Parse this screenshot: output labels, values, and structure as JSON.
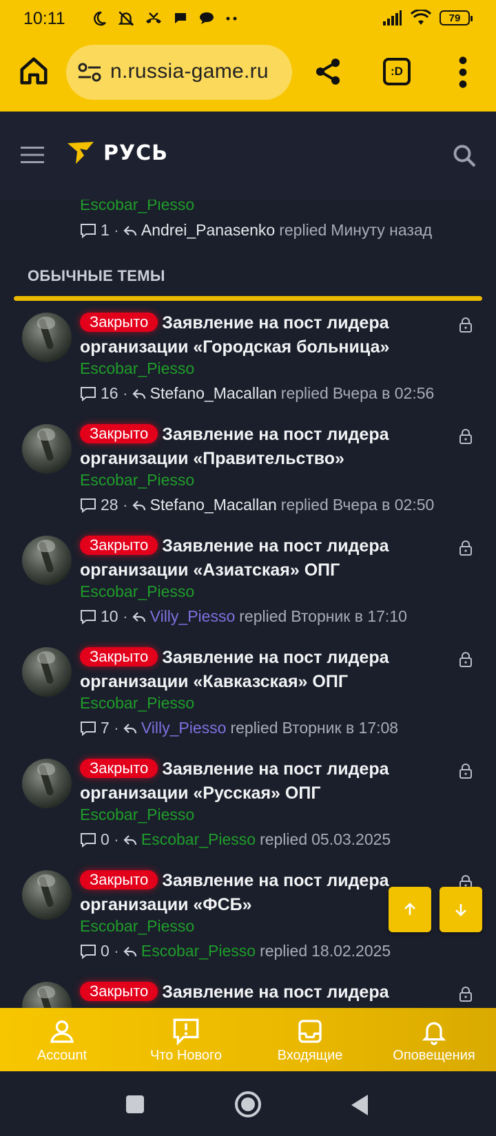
{
  "status_bar": {
    "time": "10:11",
    "battery": "79"
  },
  "browser": {
    "url": "n.russia-game.ru",
    "tab_label": ":D"
  },
  "header": {
    "logo_text": "РУСЬ"
  },
  "partial_thread": {
    "author": "Escobar_Piesso",
    "replies": "1",
    "last_poster": "Andrei_Panasenko",
    "replied_word": "replied",
    "time": "Минуту назад"
  },
  "section": {
    "title": "ОБЫЧНЫЕ ТЕМЫ"
  },
  "threads": [
    {
      "badge": "Закрыто",
      "title": "Заявление на пост лидера организации «Городская больница»",
      "author": "Escobar_Piesso",
      "replies": "16",
      "last_poster": "Stefano_Macallan",
      "last_poster_style": "white",
      "replied_word": "replied",
      "time": "Вчера в 02:56"
    },
    {
      "badge": "Закрыто",
      "title": "Заявление на пост лидера организации «Правительство»",
      "author": "Escobar_Piesso",
      "replies": "28",
      "last_poster": "Stefano_Macallan",
      "last_poster_style": "white",
      "replied_word": "replied",
      "time": "Вчера в 02:50"
    },
    {
      "badge": "Закрыто",
      "title": "Заявление на пост лидера организации «Азиатская» ОПГ",
      "author": "Escobar_Piesso",
      "replies": "10",
      "last_poster": "Villy_Piesso",
      "last_poster_style": "blue",
      "replied_word": "replied",
      "time": "Вторник в 17:10"
    },
    {
      "badge": "Закрыто",
      "title": "Заявление на пост лидера организации «Кавказская» ОПГ",
      "author": "Escobar_Piesso",
      "replies": "7",
      "last_poster": "Villy_Piesso",
      "last_poster_style": "blue",
      "replied_word": "replied",
      "time": "Вторник в 17:08"
    },
    {
      "badge": "Закрыто",
      "title": "Заявление на пост лидера организации «Русская» ОПГ",
      "author": "Escobar_Piesso",
      "replies": "0",
      "last_poster": "Escobar_Piesso",
      "last_poster_style": "green",
      "replied_word": "replied",
      "time": "05.03.2025"
    },
    {
      "badge": "Закрыто",
      "title": "Заявление на пост лидера организации «ФСБ»",
      "author": "Escobar_Piesso",
      "replies": "0",
      "last_poster": "Escobar_Piesso",
      "last_poster_style": "green",
      "replied_word": "replied",
      "time": "18.02.2025"
    },
    {
      "badge": "Закрыто",
      "title": "Заявление на пост лидера",
      "author": "",
      "replies": "",
      "last_poster": "",
      "last_poster_style": "white",
      "replied_word": "",
      "time": ""
    }
  ],
  "bottom_nav": {
    "account": "Account",
    "whats_new": "Что Нового",
    "inbox": "Входящие",
    "alerts": "Оповещения"
  },
  "colors": {
    "accent": "#f7c600",
    "badge_red": "#e3001b",
    "username_green": "#1f9d2a",
    "username_blue": "#7b72e0",
    "background": "#1b1f2b"
  }
}
